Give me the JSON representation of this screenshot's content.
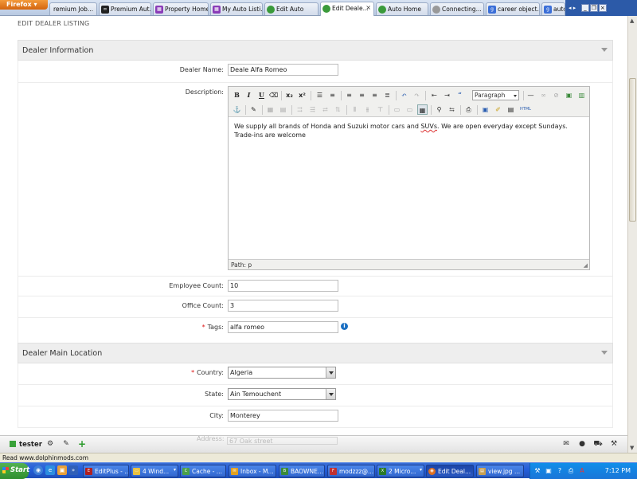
{
  "browser": {
    "menu_label": "Firefox",
    "tabs": [
      {
        "label": "remium Job..."
      },
      {
        "label": "Premium Aut..."
      },
      {
        "label": "Property Home"
      },
      {
        "label": "My Auto Listi..."
      },
      {
        "label": "Edit Auto"
      },
      {
        "label": "Edit Deale...",
        "close": "×"
      },
      {
        "label": "Auto Home"
      },
      {
        "label": "Connecting..."
      },
      {
        "label": "career object..."
      },
      {
        "label": "auto"
      }
    ],
    "tab_arrows": "◂ ▸",
    "status_text": "Read www.dolphinmods.com"
  },
  "page": {
    "header": "EDIT DEALER LISTING",
    "sections": {
      "dealer_info": "Dealer Information",
      "main_location": "Dealer Main Location"
    },
    "fields": {
      "dealer_name": {
        "label": "Dealer Name:",
        "value": "Deale Alfa Romeo"
      },
      "description": {
        "label": "Description:"
      },
      "employee_count": {
        "label": "Employee Count:",
        "value": "10"
      },
      "office_count": {
        "label": "Office Count:",
        "value": "3"
      },
      "tags": {
        "label": "Tags:",
        "value": "alfa romeo",
        "required": "*"
      },
      "country": {
        "label": "Country:",
        "value": "Algeria",
        "required": "*"
      },
      "state": {
        "label": "State:",
        "value": "Ain Temouchent"
      },
      "city": {
        "label": "City:",
        "value": "Monterey"
      },
      "address": {
        "label": "Address:",
        "value": "67 Oak street"
      }
    },
    "editor": {
      "format_select": "Paragraph",
      "text_before": "We supply all brands of Honda and Suzuki motor cars and ",
      "text_spell": "SUVs",
      "text_after": ". We are open everyday except Sundays. Trade-ins are welcome",
      "path": "Path: p",
      "toolbar": {
        "bold": "B",
        "italic": "I",
        "underline": "U",
        "strike": "S",
        "sub": "x₂",
        "sup": "x²",
        "quote": "“",
        "hr": "—",
        "html": "HTML"
      }
    }
  },
  "addon_bar": {
    "username": "tester"
  },
  "taskbar": {
    "start_label": "Start",
    "tasks": [
      {
        "label": "EditPlus - ..."
      },
      {
        "label": "4 Wind..."
      },
      {
        "label": "Cache - ..."
      },
      {
        "label": "Inbox - M..."
      },
      {
        "label": "BAOWNE..."
      },
      {
        "label": "modzzz@..."
      },
      {
        "label": "2 Micro..."
      },
      {
        "label": "Edit Deal..."
      },
      {
        "label": "view.jpg ..."
      }
    ],
    "clock": "7:12 PM"
  },
  "colors": {
    "accent_blue": "#1a6fc2",
    "required_red": "#dd1111",
    "section_bg": "#eeeeee"
  }
}
